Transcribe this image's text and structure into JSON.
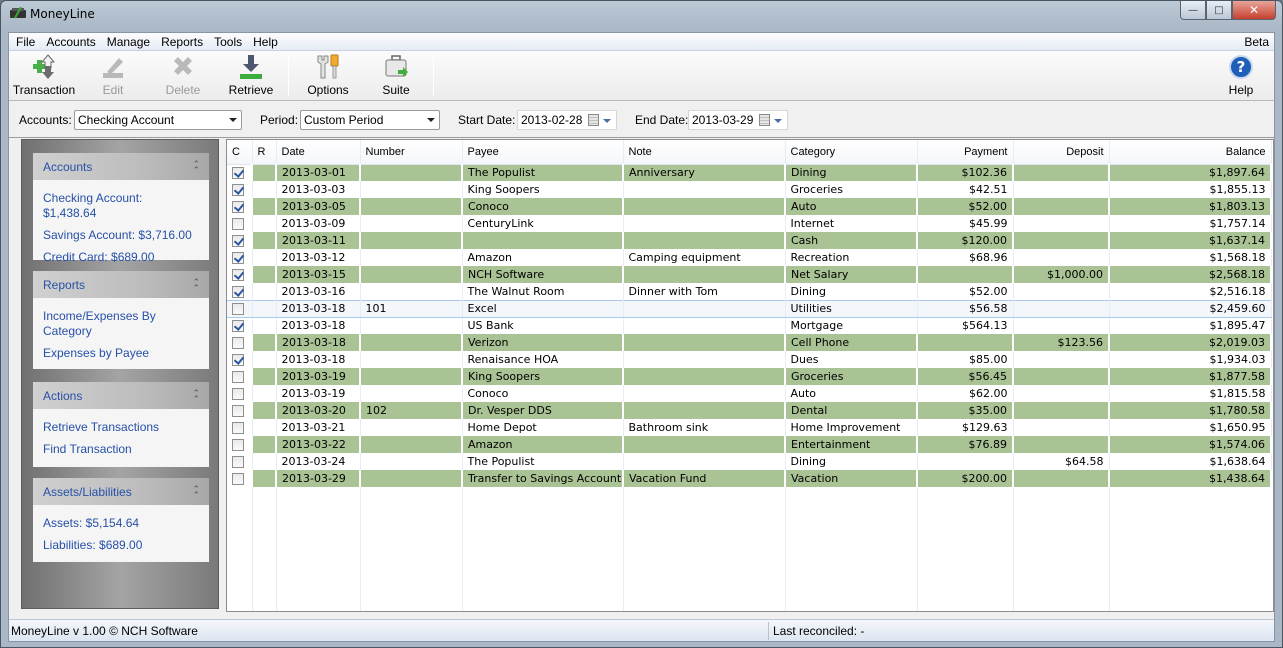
{
  "window": {
    "title": "MoneyLine",
    "controls": {
      "minimize": "—",
      "maximize": "□",
      "close": "✕"
    }
  },
  "menu": {
    "items": [
      "File",
      "Accounts",
      "Manage",
      "Reports",
      "Tools",
      "Help"
    ],
    "badge": "Beta"
  },
  "toolbar": {
    "transaction": "Transaction",
    "edit": "Edit",
    "delete": "Delete",
    "retrieve": "Retrieve",
    "options": "Options",
    "suite": "Suite",
    "help": "Help"
  },
  "filters": {
    "accounts_label": "Accounts:",
    "accounts_value": "Checking Account",
    "period_label": "Period:",
    "period_value": "Custom Period",
    "start_label": "Start Date:",
    "start_value": "2013-02-28",
    "end_label": "End Date:",
    "end_value": "2013-03-29"
  },
  "sidebar": {
    "accounts": {
      "title": "Accounts",
      "links": [
        "Checking Account: $1,438.64",
        "Savings Account: $3,716.00",
        "Credit Card: $689.00"
      ]
    },
    "reports": {
      "title": "Reports",
      "links": [
        "Income/Expenses By Category",
        "Expenses by Payee"
      ]
    },
    "actions": {
      "title": "Actions",
      "links": [
        "Retrieve Transactions",
        "Find Transaction"
      ]
    },
    "assets": {
      "title": "Assets/Liabilities",
      "links": [
        "Assets: $5,154.64",
        "Liabilities: $689.00"
      ]
    }
  },
  "grid": {
    "columns": [
      "C",
      "R",
      "Date",
      "Number",
      "Payee",
      "Note",
      "Category",
      "Payment",
      "Deposit",
      "Balance"
    ],
    "rows": [
      {
        "c": true,
        "r": "",
        "date": "2013-03-01",
        "number": "",
        "payee": "The Populist",
        "note": "Anniversary",
        "category": "Dining",
        "payment": "$102.36",
        "deposit": "",
        "balance": "$1,897.64"
      },
      {
        "c": true,
        "r": "",
        "date": "2013-03-03",
        "number": "",
        "payee": "King Soopers",
        "note": "",
        "category": "Groceries",
        "payment": "$42.51",
        "deposit": "",
        "balance": "$1,855.13"
      },
      {
        "c": true,
        "r": "",
        "date": "2013-03-05",
        "number": "",
        "payee": "Conoco",
        "note": "",
        "category": "Auto",
        "payment": "$52.00",
        "deposit": "",
        "balance": "$1,803.13"
      },
      {
        "c": false,
        "r": "",
        "date": "2013-03-09",
        "number": "",
        "payee": "CenturyLink",
        "note": "",
        "category": "Internet",
        "payment": "$45.99",
        "deposit": "",
        "balance": "$1,757.14"
      },
      {
        "c": true,
        "r": "",
        "date": "2013-03-11",
        "number": "",
        "payee": "",
        "note": "",
        "category": "Cash",
        "payment": "$120.00",
        "deposit": "",
        "balance": "$1,637.14"
      },
      {
        "c": true,
        "r": "",
        "date": "2013-03-12",
        "number": "",
        "payee": "Amazon",
        "note": "Camping equipment",
        "category": "Recreation",
        "payment": "$68.96",
        "deposit": "",
        "balance": "$1,568.18"
      },
      {
        "c": true,
        "r": "",
        "date": "2013-03-15",
        "number": "",
        "payee": "NCH Software",
        "note": "",
        "category": "Net Salary",
        "payment": "",
        "deposit": "$1,000.00",
        "balance": "$2,568.18"
      },
      {
        "c": true,
        "r": "",
        "date": "2013-03-16",
        "number": "",
        "payee": "The Walnut Room",
        "note": "Dinner with Tom",
        "category": "Dining",
        "payment": "$52.00",
        "deposit": "",
        "balance": "$2,516.18"
      },
      {
        "c": false,
        "r": "",
        "date": "2013-03-18",
        "number": "101",
        "payee": "Excel",
        "note": "",
        "category": "Utilities",
        "payment": "$56.58",
        "deposit": "",
        "balance": "$2,459.60",
        "selected": true
      },
      {
        "c": true,
        "r": "",
        "date": "2013-03-18",
        "number": "",
        "payee": "US Bank",
        "note": "",
        "category": "Mortgage",
        "payment": "$564.13",
        "deposit": "",
        "balance": "$1,895.47"
      },
      {
        "c": false,
        "r": "",
        "date": "2013-03-18",
        "number": "",
        "payee": "Verizon",
        "note": "",
        "category": "Cell Phone",
        "payment": "",
        "deposit": "$123.56",
        "balance": "$2,019.03"
      },
      {
        "c": true,
        "r": "",
        "date": "2013-03-18",
        "number": "",
        "payee": "Renaisance HOA",
        "note": "",
        "category": "Dues",
        "payment": "$85.00",
        "deposit": "",
        "balance": "$1,934.03"
      },
      {
        "c": false,
        "r": "",
        "date": "2013-03-19",
        "number": "",
        "payee": "King Soopers",
        "note": "",
        "category": "Groceries",
        "payment": "$56.45",
        "deposit": "",
        "balance": "$1,877.58"
      },
      {
        "c": false,
        "r": "",
        "date": "2013-03-19",
        "number": "",
        "payee": "Conoco",
        "note": "",
        "category": "Auto",
        "payment": "$62.00",
        "deposit": "",
        "balance": "$1,815.58"
      },
      {
        "c": false,
        "r": "",
        "date": "2013-03-20",
        "number": "102",
        "payee": "Dr. Vesper DDS",
        "note": "",
        "category": "Dental",
        "payment": "$35.00",
        "deposit": "",
        "balance": "$1,780.58"
      },
      {
        "c": false,
        "r": "",
        "date": "2013-03-21",
        "number": "",
        "payee": "Home Depot",
        "note": "Bathroom sink",
        "category": "Home Improvement",
        "payment": "$129.63",
        "deposit": "",
        "balance": "$1,650.95"
      },
      {
        "c": false,
        "r": "",
        "date": "2013-03-22",
        "number": "",
        "payee": "Amazon",
        "note": "",
        "category": "Entertainment",
        "payment": "$76.89",
        "deposit": "",
        "balance": "$1,574.06"
      },
      {
        "c": false,
        "r": "",
        "date": "2013-03-24",
        "number": "",
        "payee": "The Populist",
        "note": "",
        "category": "Dining",
        "payment": "",
        "deposit": "$64.58",
        "balance": "$1,638.64"
      },
      {
        "c": false,
        "r": "",
        "date": "2013-03-29",
        "number": "",
        "payee": "Transfer to Savings Account",
        "note": "Vacation Fund",
        "category": "Vacation",
        "payment": "$200.00",
        "deposit": "",
        "balance": "$1,438.64"
      }
    ]
  },
  "status": {
    "left": "MoneyLine v 1.00 © NCH Software",
    "right": "Last reconciled: -"
  },
  "colors": {
    "alt_row": "#aac395",
    "link": "#2650a8"
  }
}
